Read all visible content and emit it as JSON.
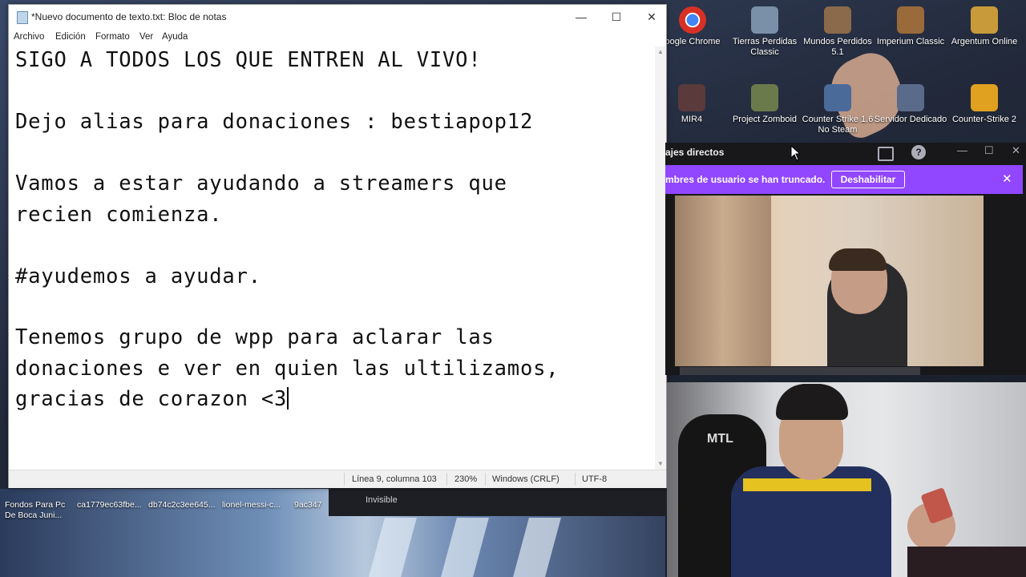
{
  "notepad": {
    "title": "*Nuevo documento de texto.txt: Bloc de notas",
    "menu": [
      "Archivo",
      "Edición",
      "Formato",
      "Ver",
      "Ayuda"
    ],
    "lines": [
      "SIGO A TODOS LOS QUE ENTREN AL VIVO!",
      "",
      "Dejo alias para donaciones : bestiapop12",
      "",
      "Vamos a estar ayudando a streamers que",
      "recien comienza.",
      "",
      "#ayudemos a ayudar.",
      "",
      "Tenemos grupo de wpp para aclarar las",
      "donaciones e ver en quien las ultilizamos,",
      "gracias de corazon <3"
    ],
    "status": {
      "position": "Línea 9, columna 103",
      "zoom": "230%",
      "line_ending": "Windows (CRLF)",
      "encoding": "UTF-8"
    }
  },
  "desktop": {
    "icons": [
      {
        "label": "oogle Chrome",
        "icon": "chrome-icon",
        "color": "#d93025"
      },
      {
        "label": "Tierras Perdidas Classic",
        "icon": "game-icon",
        "color": "#7a8fa8"
      },
      {
        "label": "Mundos Perdidos 5.1",
        "icon": "game-icon",
        "color": "#8a6a4a"
      },
      {
        "label": "Imperium Classic",
        "icon": "game-icon",
        "color": "#9a6a3a"
      },
      {
        "label": "Argentum Online",
        "icon": "game-icon",
        "color": "#c89a3a"
      },
      {
        "label": "MIR4",
        "icon": "game-icon",
        "color": "#5a3a3a"
      },
      {
        "label": "Project Zomboid",
        "icon": "game-icon",
        "color": "#6a7a4a"
      },
      {
        "label": "Counter Strike 1.6 No Steam",
        "icon": "cs-icon",
        "color": "#4a6a9a"
      },
      {
        "label": "Servidor Dedicado",
        "icon": "cs-icon",
        "color": "#5a6a8a"
      },
      {
        "label": "Counter-Strike 2",
        "icon": "cs2-icon",
        "color": "#e0a020"
      }
    ],
    "bottom_icons": [
      "Fondos Para Pc De Boca Juni...",
      "ca1779ec63fbe...",
      "db74c2c3ee645...",
      "lionel-messi-c...",
      "9ac347"
    ]
  },
  "stream_overlay": {
    "status_label": "Invisible"
  },
  "chat": {
    "title": "ajes directos",
    "banner_text": "mbres de usuario se han truncado.",
    "banner_button": "Deshabilitar",
    "accent": "#9147ff"
  },
  "facecam": {
    "chair_text": "MTL"
  }
}
